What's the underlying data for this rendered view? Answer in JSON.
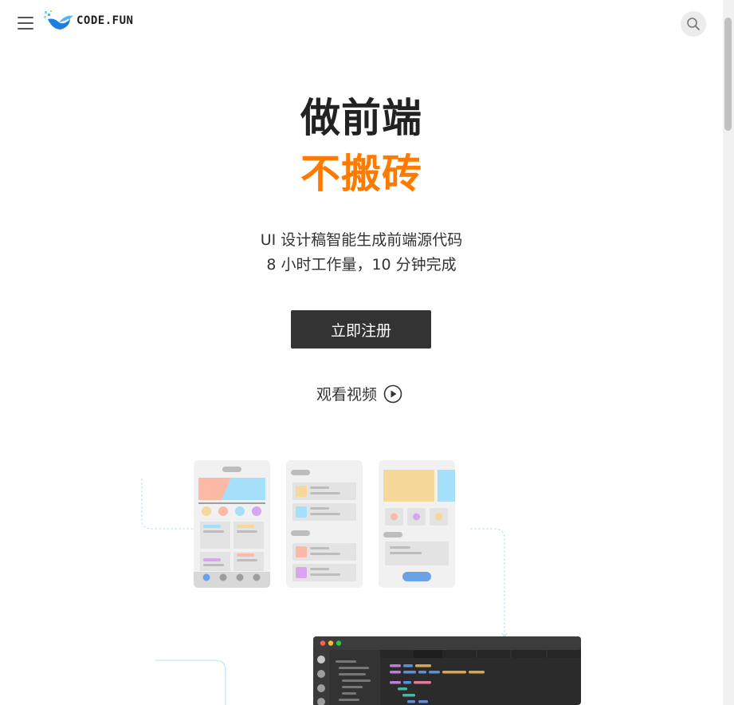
{
  "header": {
    "logo_text": "CODE.FUN",
    "menu_icon": "hamburger-menu-icon",
    "search_icon": "search-icon"
  },
  "hero": {
    "line1": "做前端",
    "line2": "不搬砖",
    "line2_color": "#ff7a00",
    "subtitle_1": "UI 设计稿智能生成前端源代码",
    "subtitle_2": "8 小时工作量，10 分钟完成"
  },
  "cta": {
    "register_label": "立即注册",
    "bg_color": "#333333"
  },
  "video": {
    "label": "观看视频",
    "icon": "play-circle-icon"
  },
  "colors": {
    "peach": "#fbb9a6",
    "sky": "#a6dff9",
    "yellow": "#f5d89a",
    "purple": "#d7a6ef",
    "blue_button": "#6aa3e5",
    "editor_bg": "#2b2b2b"
  }
}
